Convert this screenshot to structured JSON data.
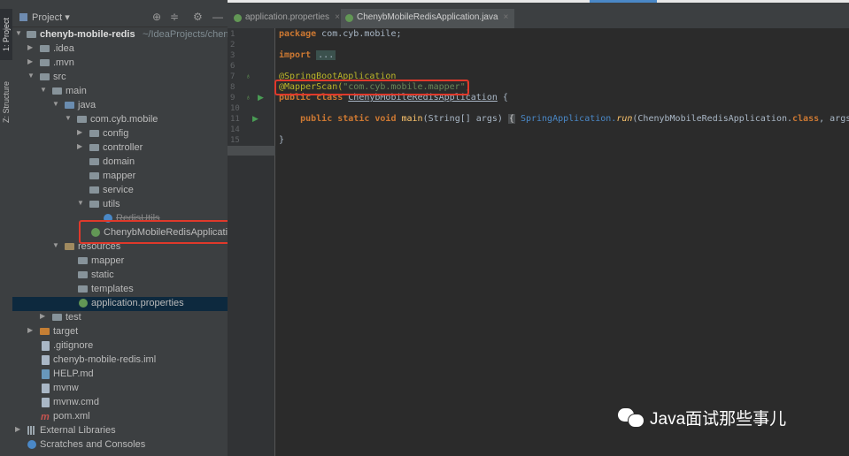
{
  "toolstrip": {
    "project_tab": "1: Project",
    "structure_tab": "Z: Structure"
  },
  "project_panel": {
    "title": "Project",
    "tree": [
      {
        "label": "chenyb-mobile-redis",
        "hint": "~/IdeaProjects/chen",
        "icon": "module-icon"
      },
      {
        "label": ".idea",
        "icon": "folder-icon"
      },
      {
        "label": ".mvn",
        "icon": "folder-icon"
      },
      {
        "label": "src",
        "icon": "folder-icon"
      },
      {
        "label": "main",
        "icon": "folder-icon"
      },
      {
        "label": "java",
        "icon": "source-folder-icon"
      },
      {
        "label": "com.cyb.mobile",
        "icon": "package-icon"
      },
      {
        "label": "config",
        "icon": "package-icon"
      },
      {
        "label": "controller",
        "icon": "package-icon"
      },
      {
        "label": "domain",
        "icon": "package-icon"
      },
      {
        "label": "mapper",
        "icon": "package-icon"
      },
      {
        "label": "service",
        "icon": "package-icon"
      },
      {
        "label": "utils",
        "icon": "package-icon"
      },
      {
        "label": "RedisUtils",
        "icon": "class-icon"
      },
      {
        "label": "ChenybMobileRedisApplicati",
        "icon": "spring-boot-class-icon"
      },
      {
        "label": "resources",
        "icon": "resources-folder-icon"
      },
      {
        "label": "mapper",
        "icon": "folder-icon"
      },
      {
        "label": "static",
        "icon": "folder-icon"
      },
      {
        "label": "templates",
        "icon": "folder-icon"
      },
      {
        "label": "application.properties",
        "icon": "spring-properties-icon"
      },
      {
        "label": "test",
        "icon": "folder-icon"
      },
      {
        "label": "target",
        "icon": "excluded-folder-icon"
      },
      {
        "label": ".gitignore",
        "icon": "gitignore-icon"
      },
      {
        "label": "chenyb-mobile-redis.iml",
        "icon": "iml-file-icon"
      },
      {
        "label": "HELP.md",
        "icon": "markdown-file-icon"
      },
      {
        "label": "mvnw",
        "icon": "script-file-icon"
      },
      {
        "label": "mvnw.cmd",
        "icon": "script-file-icon"
      },
      {
        "label": "pom.xml",
        "icon": "maven-icon"
      },
      {
        "label": "External Libraries",
        "icon": "libraries-icon"
      },
      {
        "label": "Scratches and Consoles",
        "icon": "scratches-icon"
      }
    ]
  },
  "editor": {
    "tabs": [
      {
        "label": "application.properties"
      },
      {
        "label": "ChenybMobileRedisApplication.java"
      }
    ],
    "line_numbers": [
      "1",
      "2",
      "3",
      "6",
      "7",
      "8",
      "9",
      "10",
      "11",
      "14",
      "15"
    ],
    "code": {
      "l1_kw": "package",
      "l1_rest": " com.cyb.mobile;",
      "l3_kw": "import",
      "l3_fold": "...",
      "l7": "@SpringBootApplication",
      "l8_ann": "@MapperScan(",
      "l8_str": "\"com.cyb.mobile.mapper\"",
      "l8_end": ")",
      "l9_kw": "public class ",
      "l9_cls": "ChenybMobileRedisApplication",
      "l9_end": " {",
      "l11_kw": "public static void ",
      "l11_mth": "main",
      "l11_args": "(String[] args) ",
      "l11_open": "{",
      "l11_spring": " SpringApplication.",
      "l11_run": "run",
      "l11_call": "(ChenybMobileRedisApplication.",
      "l11_class": "class",
      "l11_tail": ", args); ",
      "l11_close": "}",
      "l15": "}"
    }
  },
  "watermark": {
    "text": "Java面试那些事儿"
  },
  "colors": {
    "highlight_box": "#e0392b",
    "accent": "#4a88c7"
  }
}
